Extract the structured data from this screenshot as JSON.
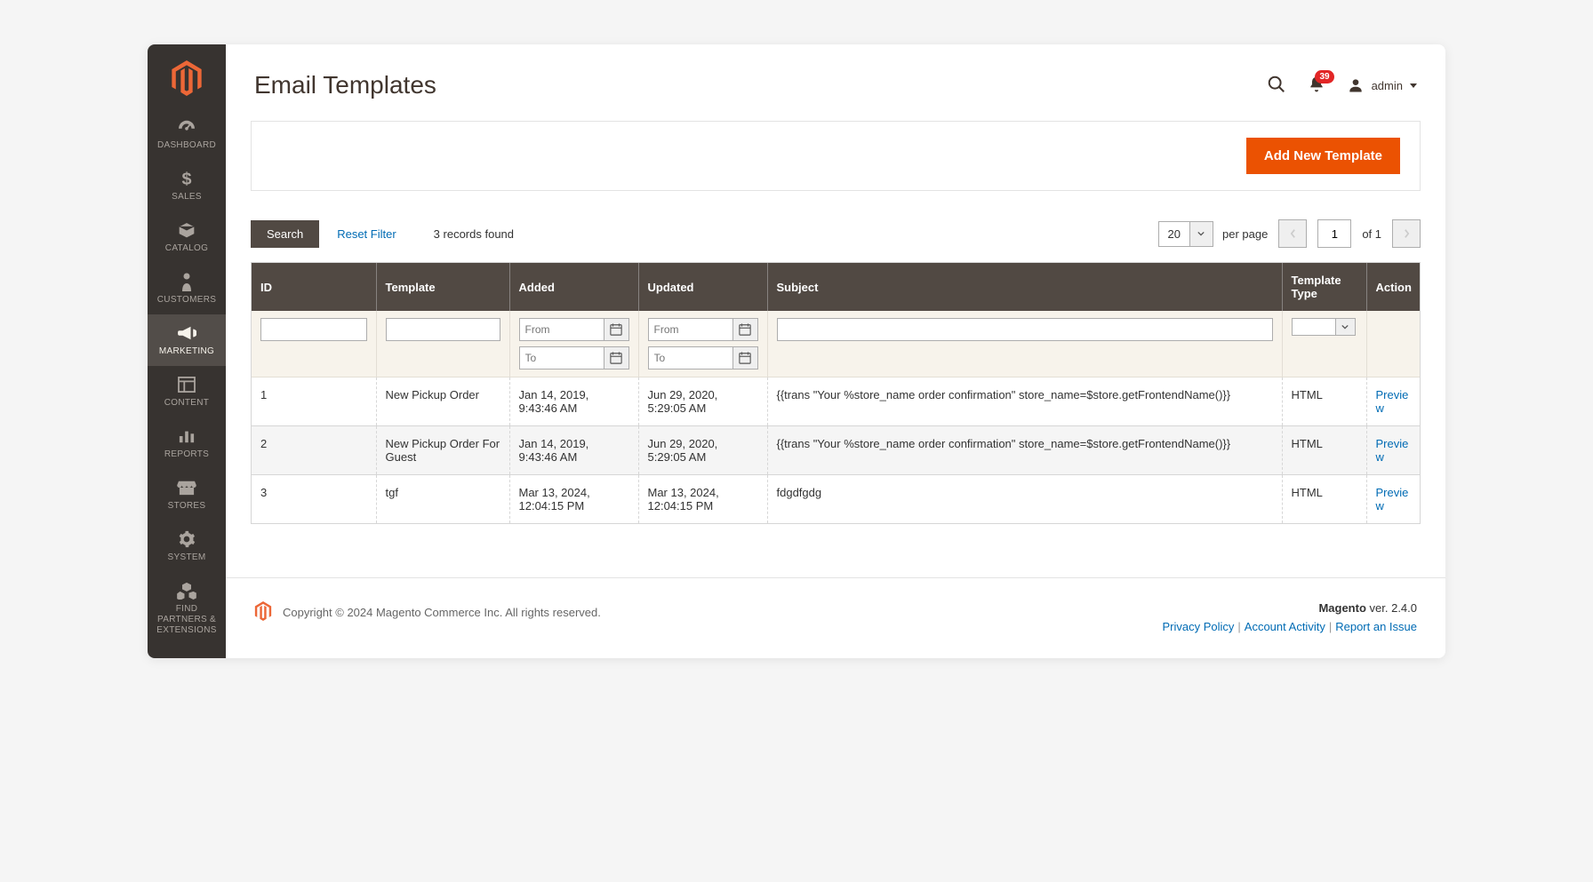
{
  "sidebar": {
    "items": [
      {
        "label": "DASHBOARD",
        "icon": "dashboard"
      },
      {
        "label": "SALES",
        "icon": "dollar"
      },
      {
        "label": "CATALOG",
        "icon": "box"
      },
      {
        "label": "CUSTOMERS",
        "icon": "person"
      },
      {
        "label": "MARKETING",
        "icon": "megaphone",
        "active": true
      },
      {
        "label": "CONTENT",
        "icon": "layout"
      },
      {
        "label": "REPORTS",
        "icon": "bars"
      },
      {
        "label": "STORES",
        "icon": "storefront"
      },
      {
        "label": "SYSTEM",
        "icon": "gear"
      },
      {
        "label": "FIND PARTNERS & EXTENSIONS",
        "icon": "cubes"
      }
    ]
  },
  "header": {
    "title": "Email Templates",
    "notif_count": "39",
    "user_label": "admin"
  },
  "actions": {
    "add_new_template": "Add New Template"
  },
  "toolbar": {
    "search_label": "Search",
    "reset_label": "Reset Filter",
    "records_found": "3 records found",
    "per_page_value": "20",
    "per_page_label": "per page",
    "page_current": "1",
    "page_of": "of 1"
  },
  "grid": {
    "headers": {
      "id": "ID",
      "template": "Template",
      "added": "Added",
      "updated": "Updated",
      "subject": "Subject",
      "type": "Template Type",
      "action": "Action"
    },
    "filters": {
      "from_placeholder": "From",
      "to_placeholder": "To"
    },
    "rows": [
      {
        "id": "1",
        "template": "New Pickup Order",
        "added": "Jan 14, 2019, 9:43:46 AM",
        "updated": "Jun 29, 2020, 5:29:05 AM",
        "subject": "{{trans \"Your %store_name order confirmation\" store_name=$store.getFrontendName()}}",
        "type": "HTML",
        "action": "Preview"
      },
      {
        "id": "2",
        "template": "New Pickup Order For Guest",
        "added": "Jan 14, 2019, 9:43:46 AM",
        "updated": "Jun 29, 2020, 5:29:05 AM",
        "subject": "{{trans \"Your %store_name order confirmation\" store_name=$store.getFrontendName()}}",
        "type": "HTML",
        "action": "Preview"
      },
      {
        "id": "3",
        "template": "tgf",
        "added": "Mar 13, 2024, 12:04:15 PM",
        "updated": "Mar 13, 2024, 12:04:15 PM",
        "subject": "fdgdfgdg",
        "type": "HTML",
        "action": "Preview"
      }
    ]
  },
  "footer": {
    "copyright": "Copyright © 2024 Magento Commerce Inc. All rights reserved.",
    "brand": "Magento",
    "version": " ver. 2.4.0",
    "privacy": "Privacy Policy",
    "activity": "Account Activity",
    "report": "Report an Issue"
  }
}
